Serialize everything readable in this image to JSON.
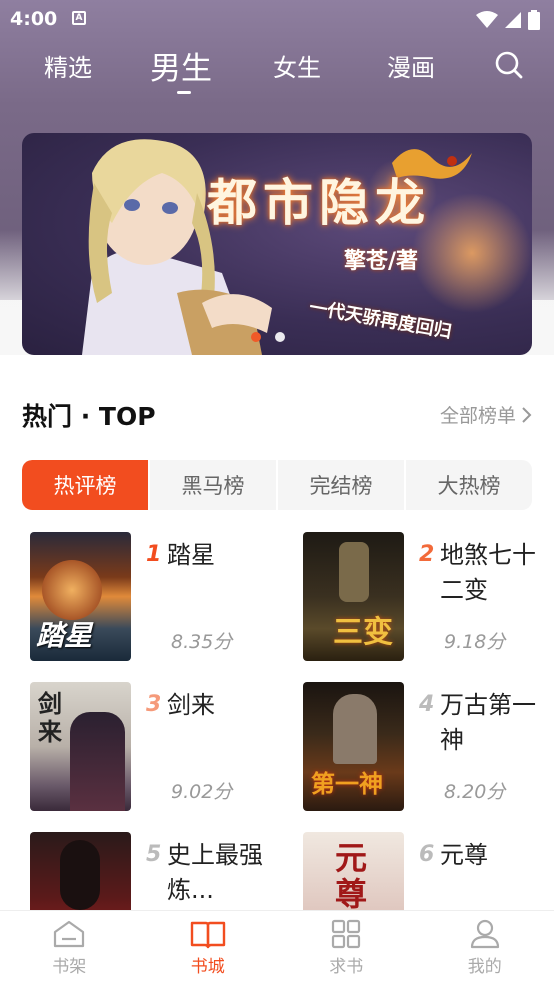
{
  "status_bar": {
    "time": "4:00",
    "a_icon": "A"
  },
  "top_nav": {
    "tabs": [
      {
        "label": "精选"
      },
      {
        "label": "男生"
      },
      {
        "label": "女生"
      },
      {
        "label": "漫画"
      }
    ],
    "active_index": 1
  },
  "banner": {
    "title": "都市隐龙",
    "author": "擎苍/著",
    "slogan": "一代天骄再度回归",
    "slide_count": 2,
    "active_slide": 0
  },
  "hot_section": {
    "title": "热门 · TOP",
    "more_label": "全部榜单"
  },
  "rank_tabs": [
    {
      "label": "热评榜"
    },
    {
      "label": "黑马榜"
    },
    {
      "label": "完结榜"
    },
    {
      "label": "大热榜"
    }
  ],
  "books": [
    {
      "rank": "1",
      "title": "踏星",
      "score": "8.35分",
      "cover_text": "踏星"
    },
    {
      "rank": "2",
      "title": "地煞七十二变",
      "score": "9.18分",
      "cover_text": "三变"
    },
    {
      "rank": "3",
      "title": "剑来",
      "score": "9.02分",
      "cover_text": "剑来"
    },
    {
      "rank": "4",
      "title": "万古第一神",
      "score": "8.20分",
      "cover_text": "第一神"
    },
    {
      "rank": "5",
      "title": "史上最强炼...",
      "score": "",
      "cover_text": ""
    },
    {
      "rank": "6",
      "title": "元尊",
      "score": "",
      "cover_text": "元尊"
    }
  ],
  "rank_colors": [
    "#f24d1f",
    "#f26a3a",
    "#f59a7a",
    "#bbbbbb",
    "#bbbbbb",
    "#bbbbbb"
  ],
  "bottom_nav": [
    {
      "label": "书架",
      "icon": "bookshelf-icon"
    },
    {
      "label": "书城",
      "icon": "bookstore-icon"
    },
    {
      "label": "求书",
      "icon": "request-icon"
    },
    {
      "label": "我的",
      "icon": "profile-icon"
    }
  ],
  "colors": {
    "accent": "#f24d1f"
  }
}
